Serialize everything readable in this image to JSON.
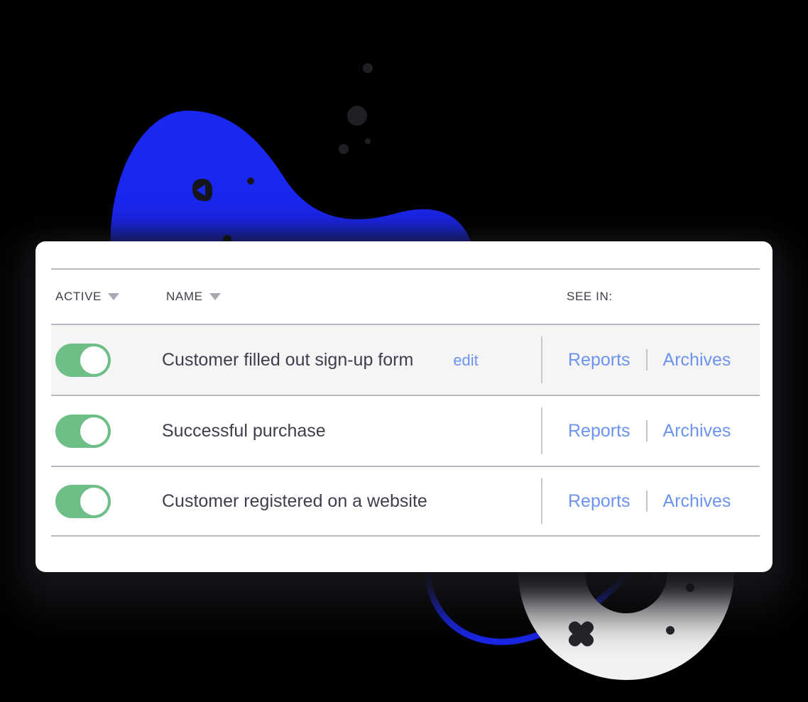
{
  "theme": {
    "background": "#000000",
    "card_background": "#ffffff",
    "accent_blue": "#6c93ef",
    "blob_blue": "#1a27f0",
    "toggle_green": "#6dbf87",
    "rule_gray": "#b6b8bf",
    "row_highlight": "#f5f5f6",
    "text_dark": "#3d404c",
    "dot_dark": "#1f1f24"
  },
  "table": {
    "columns": [
      {
        "id": "active",
        "label": "ACTIVE",
        "sort_icon": "caret-down-icon",
        "sortable": true
      },
      {
        "id": "name",
        "label": "NAME",
        "sort_icon": "caret-down-icon",
        "sortable": true
      },
      {
        "id": "see_in",
        "label": "SEE IN:",
        "sort_icon": null,
        "sortable": false
      }
    ],
    "rows": [
      {
        "active": true,
        "toggle_state": "on",
        "name": "Customer filled out sign-up form",
        "edit_label": "edit",
        "has_edit": true,
        "highlighted": true,
        "see_in": [
          "Reports",
          "Archives"
        ]
      },
      {
        "active": true,
        "toggle_state": "on",
        "name": "Successful purchase",
        "edit_label": "",
        "has_edit": false,
        "highlighted": false,
        "see_in": [
          "Reports",
          "Archives"
        ]
      },
      {
        "active": true,
        "toggle_state": "on",
        "name": "Customer registered on a website",
        "edit_label": "",
        "has_edit": false,
        "highlighted": false,
        "see_in": [
          "Reports",
          "Archives"
        ]
      }
    ]
  },
  "decorations": {
    "blob": {
      "name": "blue-blob-shape",
      "color": "#1a27f0"
    },
    "play_badge": {
      "name": "play-triangle-icon",
      "color": "#15161c"
    },
    "ring": {
      "name": "white-ring-shape",
      "color": "#f2f2f3"
    },
    "curve": {
      "name": "blue-curve-stroke",
      "color": "#1a27f0"
    },
    "cross": {
      "name": "cross-mark-icon",
      "color": "#26262c"
    },
    "dots": {
      "name": "dot-cluster",
      "color": "#1f1f24",
      "count": 9
    }
  }
}
